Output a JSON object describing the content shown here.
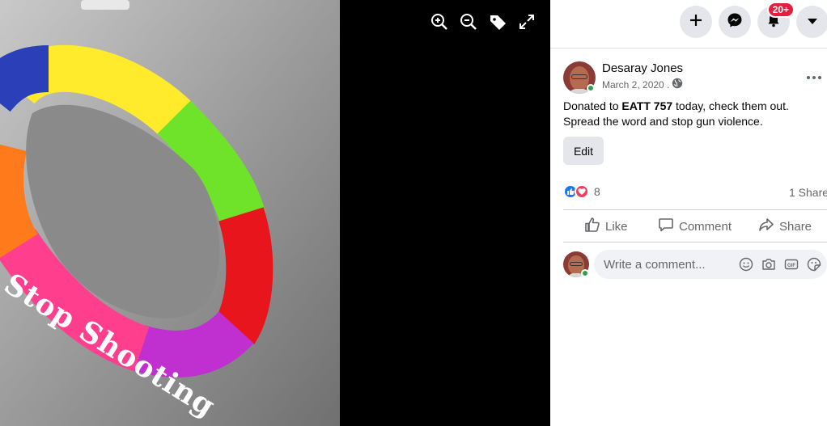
{
  "viewer": {
    "tools": [
      {
        "name": "zoom-in-icon"
      },
      {
        "name": "zoom-out-icon"
      },
      {
        "name": "tag-icon"
      },
      {
        "name": "fullscreen-icon"
      }
    ],
    "photo_text": "Stop Shooting"
  },
  "topbar": {
    "notification_badge": "20+"
  },
  "post": {
    "author": "Desaray Jones",
    "date": "March 2, 2020 .",
    "text_line1_pre": "Donated to ",
    "text_line1_bold": "EATT 757",
    "text_line1_post": " today, check them out.",
    "text_line2": "Spread the word and stop gun violence.",
    "edit_label": "Edit",
    "reaction_count": "8",
    "share_count": "1 Share"
  },
  "actions": {
    "like": "Like",
    "comment": "Comment",
    "share": "Share"
  },
  "comment": {
    "placeholder": "Write a comment..."
  },
  "colors": {
    "fb_blue": "#1877f2",
    "love_red": "#f33e58",
    "notif_red": "#e41e3f",
    "online_green": "#31a24c"
  }
}
